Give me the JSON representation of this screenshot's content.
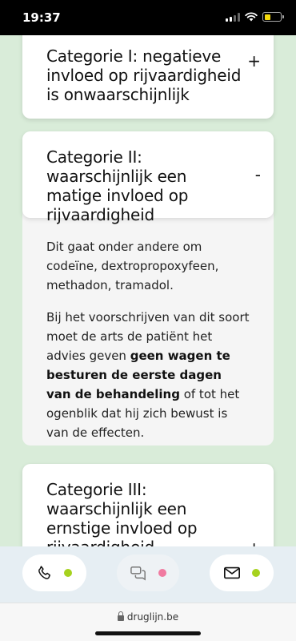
{
  "status_bar": {
    "time": "19:37"
  },
  "cards": [
    {
      "title": "Categorie I: negatieve invloed op rijvaardigheid is onwaarschijnlijk",
      "toggle": "+"
    },
    {
      "title": "Categorie II: waarschijnlijk een matige invloed op rijvaardigheid",
      "toggle": "-",
      "body": {
        "p1": "Dit gaat onder andere om codeïne, dextropropoxyfeen, methadon, tramadol.",
        "p2_before": "Bij het voorschrijven van dit soort moet de arts de patiënt het advies geven ",
        "p2_bold": "geen wagen te besturen de eerste dagen van de behandeling",
        "p2_after": " of tot het ogenblik dat hij zich bewust is van de effecten."
      }
    },
    {
      "title": "Categorie III: waarschijnlijk een ernstige invloed op rijvaardigheid",
      "toggle": "+"
    }
  ],
  "action_bar": {
    "phone": {
      "icon": "phone-icon",
      "dot_color": "#a6d21e"
    },
    "chat": {
      "icon": "chat-icon",
      "dot_color": "#f07aa0"
    },
    "mail": {
      "icon": "mail-icon",
      "dot_color": "#a6d21e"
    }
  },
  "browser": {
    "url": "druglijn.be"
  }
}
